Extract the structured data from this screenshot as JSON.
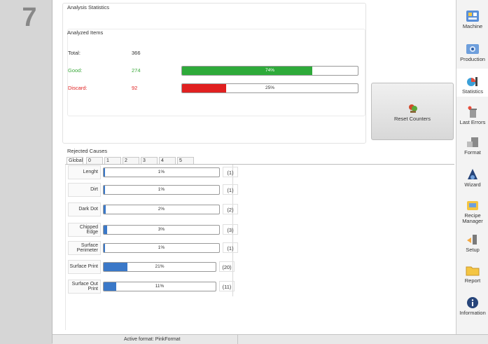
{
  "step_number": "7",
  "stats": {
    "title": "Analysis Statistics",
    "analyzed_title": "Analyzed Items",
    "total_label": "Total:",
    "total_value": "366",
    "good_label": "Good:",
    "good_value": "274",
    "good_percent_label": "74%",
    "good_fraction": 0.74,
    "discard_label": "Discard:",
    "discard_value": "92",
    "discard_percent_label": "25%",
    "discard_fraction": 0.25,
    "good_color": "#2eaa3a",
    "discard_color": "#e02020"
  },
  "reset_button_label": "Reset Counters",
  "rejected": {
    "title": "Rejected Causes",
    "tabs": [
      "Global",
      "0",
      "1",
      "2",
      "3",
      "4",
      "5"
    ],
    "bar_color": "#3a78c8",
    "causes": [
      {
        "name": "Lenght",
        "percent_label": "1%",
        "fraction": 0.01,
        "count": "(1)"
      },
      {
        "name": "Dirt",
        "percent_label": "1%",
        "fraction": 0.01,
        "count": "(1)"
      },
      {
        "name": "Dark Dot",
        "percent_label": "2%",
        "fraction": 0.02,
        "count": "(2)"
      },
      {
        "name": "Chipped Edge",
        "percent_label": "3%",
        "fraction": 0.03,
        "count": "(3)"
      },
      {
        "name": "Surface Perimeter",
        "percent_label": "1%",
        "fraction": 0.01,
        "count": "(1)"
      },
      {
        "name": "Surface Print",
        "percent_label": "21%",
        "fraction": 0.21,
        "count": "(20)"
      },
      {
        "name": "Surface Out Print",
        "percent_label": "11%",
        "fraction": 0.11,
        "count": "(11)"
      }
    ]
  },
  "sidebar": {
    "items": [
      {
        "label": "Machine",
        "icon": "machine-icon"
      },
      {
        "label": "Production",
        "icon": "production-icon"
      },
      {
        "label": "Statistics",
        "icon": "statistics-icon"
      },
      {
        "label": "Last Errors",
        "icon": "last-errors-icon"
      },
      {
        "label": "Format",
        "icon": "format-icon"
      },
      {
        "label": "Wizard",
        "icon": "wizard-icon"
      },
      {
        "label": "Recipe Manager",
        "icon": "recipe-manager-icon"
      },
      {
        "label": "Setup",
        "icon": "setup-icon"
      },
      {
        "label": "Report",
        "icon": "report-icon"
      },
      {
        "label": "Information",
        "icon": "information-icon"
      }
    ]
  },
  "status": {
    "active_format": "Active format: PinkFormat"
  }
}
